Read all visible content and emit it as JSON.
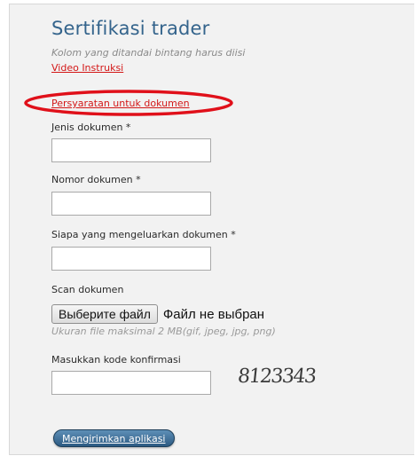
{
  "form": {
    "title": "Sertifikasi trader",
    "subtitle": "Kolom yang ditandai bintang harus diisi",
    "video_link": "Video Instruksi",
    "requirements_link": "Persyaratan untuk dokumen",
    "fields": {
      "doc_type": {
        "label": "Jenis dokumen *",
        "value": ""
      },
      "doc_number": {
        "label": "Nomor dokumen *",
        "value": ""
      },
      "issuer": {
        "label": "Siapa yang mengeluarkan dokumen *",
        "value": ""
      },
      "scan": {
        "label": "Scan dokumen",
        "button_label": "Выберите файл",
        "status": "Файл не выбран",
        "hint": "Ukuran file maksimal 2 MB(gif, jpeg, jpg, png)"
      },
      "captcha": {
        "label": "Masukkan kode konfirmasi",
        "value": "",
        "code": "8123343"
      }
    },
    "submit_label": "Mengirimkan aplikasi"
  },
  "colors": {
    "title": "#34648c",
    "link": "#d31818",
    "highlight_oval": "#e0101a",
    "panel_background": "#f2f2f2",
    "submit_button": "#3d6d95"
  },
  "icons": {
    "annotation": "red-highlight-oval"
  }
}
